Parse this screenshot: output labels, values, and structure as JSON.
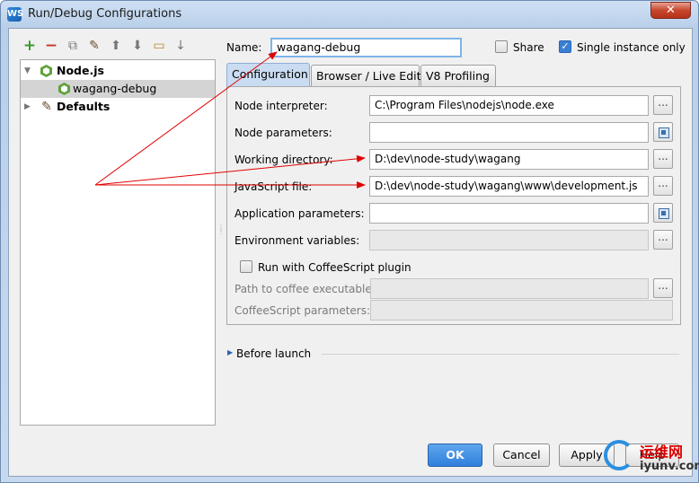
{
  "window": {
    "title": "Run/Debug Configurations",
    "app_icon_text": "WS",
    "close_glyph": "✕"
  },
  "toolbar": {
    "icons": [
      "add-icon",
      "remove-icon",
      "copy-icon",
      "edit-defaults-icon",
      "move-up-icon",
      "move-down-icon",
      "folder-icon",
      "sort-icon"
    ],
    "glyphs": [
      "+",
      "−",
      "⧉",
      "✎",
      "⬆",
      "⬇",
      "▭",
      "↓"
    ]
  },
  "tree": {
    "items": [
      {
        "label": "Node.js",
        "expanded": true
      },
      {
        "label": "wagang-debug"
      },
      {
        "label": "Defaults",
        "expanded": false
      }
    ]
  },
  "header": {
    "name_label": "Name:",
    "name_value": "wagang-debug",
    "share_label": "Share",
    "share_checked": false,
    "single_instance_label": "Single instance only",
    "single_instance_checked": true
  },
  "tabs": [
    "Configuration",
    "Browser / Live Edit",
    "V8 Profiling"
  ],
  "config": {
    "node_interpreter_label": "Node interpreter:",
    "node_interpreter_value": "C:\\Program Files\\nodejs\\node.exe",
    "node_parameters_label": "Node parameters:",
    "node_parameters_value": "",
    "working_directory_label": "Working directory:",
    "working_directory_value": "D:\\dev\\node-study\\wagang",
    "javascript_file_label": "JavaScript file:",
    "javascript_file_value": "D:\\dev\\node-study\\wagang\\www\\development.js",
    "application_parameters_label": "Application parameters:",
    "application_parameters_value": "",
    "environment_variables_label": "Environment variables:",
    "environment_variables_value": "",
    "coffee_plugin_label": "Run with CoffeeScript plugin",
    "coffee_plugin_checked": false,
    "coffee_path_label": "Path to coffee executable:",
    "coffee_params_label": "CoffeeScript parameters:"
  },
  "before_launch_label": "Before launch",
  "buttons": {
    "ok": "OK",
    "cancel": "Cancel",
    "apply": "Apply",
    "help": "Help"
  },
  "dots": "...",
  "watermark": {
    "line1": "运维网",
    "line2": "iyunv.com"
  },
  "colors": {
    "accent": "#3a7fd6",
    "annotation_arrow": "#e00000",
    "node_green": "#5fa23a"
  }
}
